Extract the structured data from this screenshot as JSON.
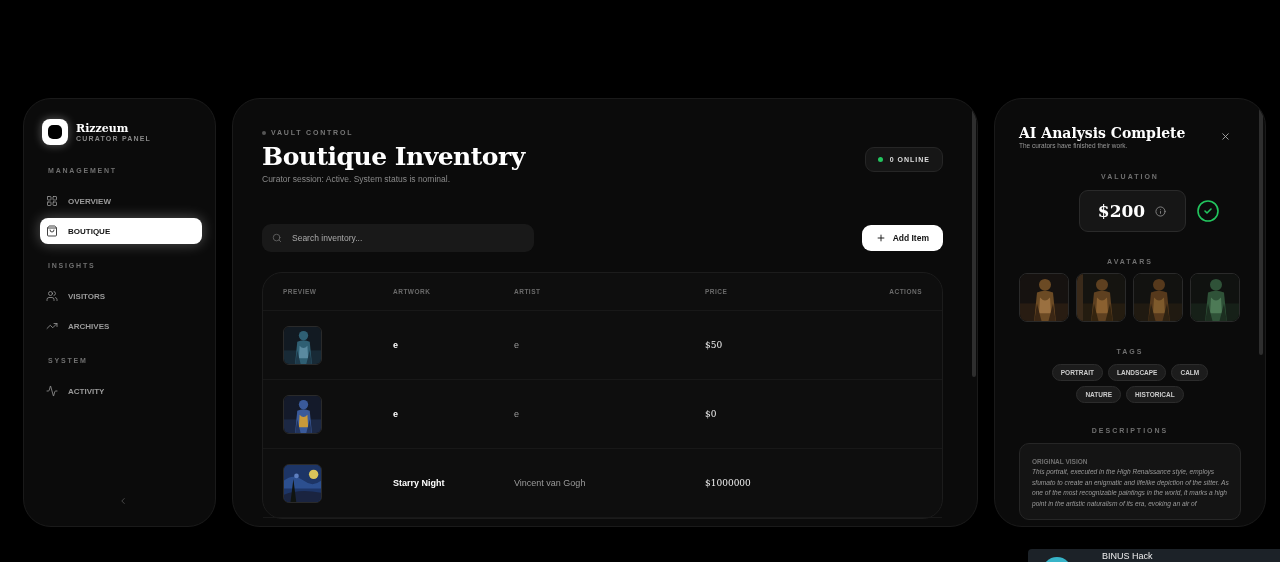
{
  "sidebar": {
    "brand": {
      "name": "Rizzeum",
      "subtitle": "CURATOR PANEL"
    },
    "sections": [
      {
        "heading": "MANAGEMENT",
        "items": [
          {
            "label": "OVERVIEW",
            "selected": false
          },
          {
            "label": "BOUTIQUE",
            "selected": true
          }
        ]
      },
      {
        "heading": "INSIGHTS",
        "items": [
          {
            "label": "VISITORS",
            "selected": false
          },
          {
            "label": "ARCHIVES",
            "selected": false
          }
        ]
      },
      {
        "heading": "SYSTEM",
        "items": [
          {
            "label": "ACTIVITY",
            "selected": false
          }
        ]
      }
    ]
  },
  "main": {
    "eyebrow": "VAULT CONTROL",
    "title": "Boutique Inventory",
    "subtitle": "Curator session: Active. System status is nominal.",
    "status": {
      "label": "0 ONLINE",
      "online": true
    },
    "search": {
      "placeholder": "Search inventory..."
    },
    "add_button": "Add Item",
    "table": {
      "columns": [
        "PREVIEW",
        "ARTWORK",
        "ARTIST",
        "PRICE",
        "ACTIONS"
      ],
      "rows": [
        {
          "artwork": "e",
          "artist": "e",
          "price": "$50"
        },
        {
          "artwork": "e",
          "artist": "e",
          "price": "$0"
        },
        {
          "artwork": "Starry Night",
          "artist": "Vincent van Gogh",
          "price": "$1000000"
        }
      ]
    }
  },
  "analysis": {
    "title": "AI Analysis Complete",
    "subtitle": "The curators have finished their work.",
    "valuation_label": "VALUATION",
    "value": "$200",
    "verified": true,
    "avatars_label": "AVATARS",
    "tags_label": "TAGS",
    "tags": [
      "PORTRAIT",
      "LANDSCAPE",
      "CALM",
      "NATURE",
      "HISTORICAL"
    ],
    "descriptions_label": "DESCRIPTIONS",
    "description": {
      "label": "ORIGINAL VISION",
      "text": "This portrait, executed in the High Renaissance style, employs sfumato to create an enigmatic and lifelike depiction of the sitter. As one of the most recognizable paintings in the world, it marks a high point in the artistic naturalism of its era, evoking an air of"
    }
  },
  "toast": {
    "title": "BINUS Hack"
  }
}
